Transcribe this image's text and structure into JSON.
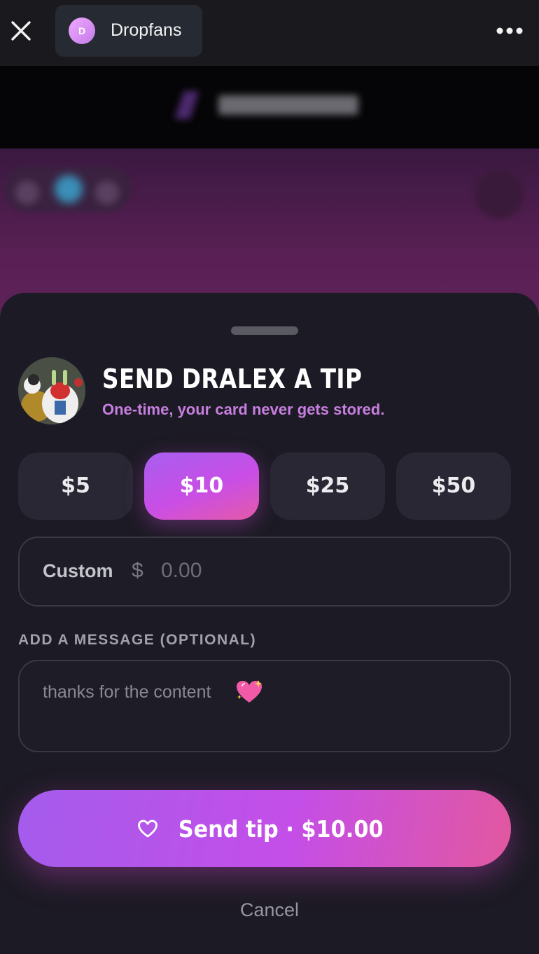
{
  "browser": {
    "tab_title": "Dropfans",
    "tab_avatar_letter": "D",
    "close_icon": "close-icon",
    "more_icon": "more-horizontal-icon"
  },
  "sheet": {
    "title": "SEND DRALEX A TIP",
    "subtitle": "One-time, your card never gets stored.",
    "amounts": [
      {
        "label": "$5",
        "selected": false
      },
      {
        "label": "$10",
        "selected": true
      },
      {
        "label": "$25",
        "selected": false
      },
      {
        "label": "$50",
        "selected": false
      }
    ],
    "custom": {
      "label": "Custom",
      "currency": "$",
      "placeholder": "0.00"
    },
    "message": {
      "label": "ADD A MESSAGE (OPTIONAL)",
      "text": "thanks for the content",
      "emoji_icon": "sparkling-heart-icon"
    },
    "send_button": "Send tip · $10.00",
    "cancel": "Cancel"
  },
  "colors": {
    "accent_start": "#a45cec",
    "accent_end": "#e2589f",
    "subtitle": "#c77fe0",
    "sheet_bg": "#1c1a24"
  }
}
